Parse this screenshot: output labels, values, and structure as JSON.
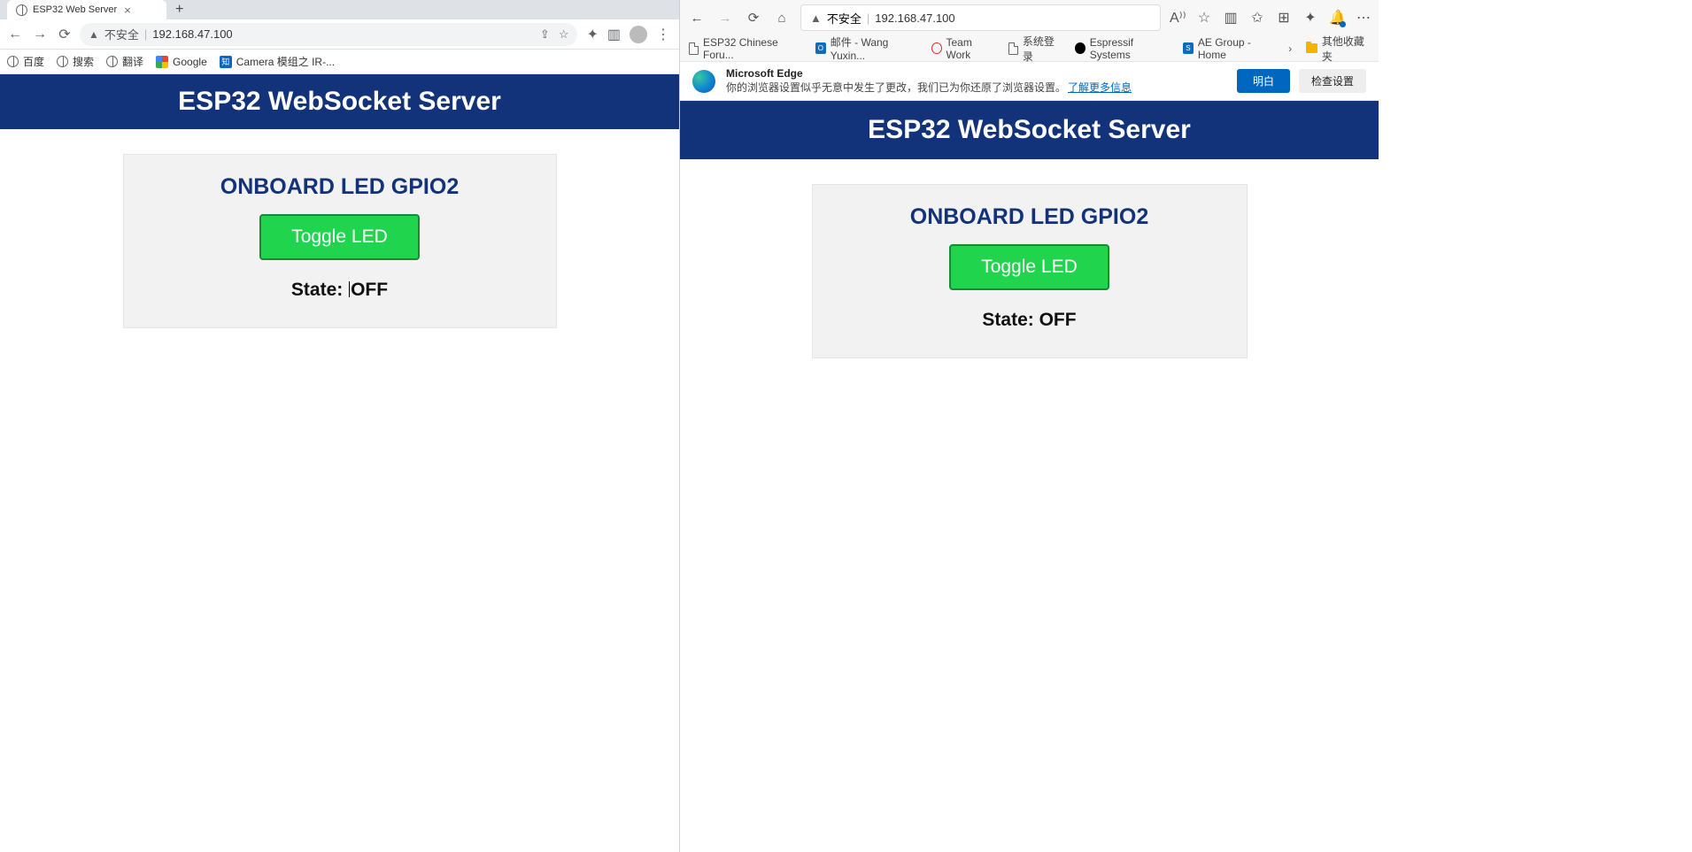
{
  "chrome": {
    "tab_title": "ESP32 Web Server",
    "address_warn": "不安全",
    "url": "192.168.47.100",
    "bookmarks": {
      "baidu": "百度",
      "sousuo": "搜索",
      "fanyi": "翻译",
      "google": "Google",
      "camera": "Camera 模组之 IR-..."
    }
  },
  "edge": {
    "address_warn": "不安全",
    "url": "192.168.47.100",
    "readaloud": "A⁾⁾",
    "bookmarks": {
      "esp32forum": "ESP32 Chinese Foru...",
      "mail": "邮件 - Wang Yuxin...",
      "teamwork": "Team Work",
      "syslogin": "系统登录",
      "espressif": "Espressif Systems",
      "aegroup": "AE Group - Home",
      "other": "其他收藏夹"
    },
    "info": {
      "title": "Microsoft Edge",
      "body": "你的浏览器设置似乎无意中发生了更改，我们已为你还原了浏览器设置。",
      "link": "了解更多信息",
      "ok": "明白",
      "check": "检查设置"
    }
  },
  "left_page": {
    "hero": "ESP32 WebSocket Server",
    "card_title": "ONBOARD LED GPIO2",
    "toggle": "Toggle LED",
    "state_label": "State: ",
    "state_val": "OFF"
  },
  "right_page": {
    "hero": "ESP32 WebSocket Server",
    "card_title": "ONBOARD LED GPIO2",
    "toggle": "Toggle LED",
    "state_label": "State: ",
    "state_val": "OFF"
  }
}
